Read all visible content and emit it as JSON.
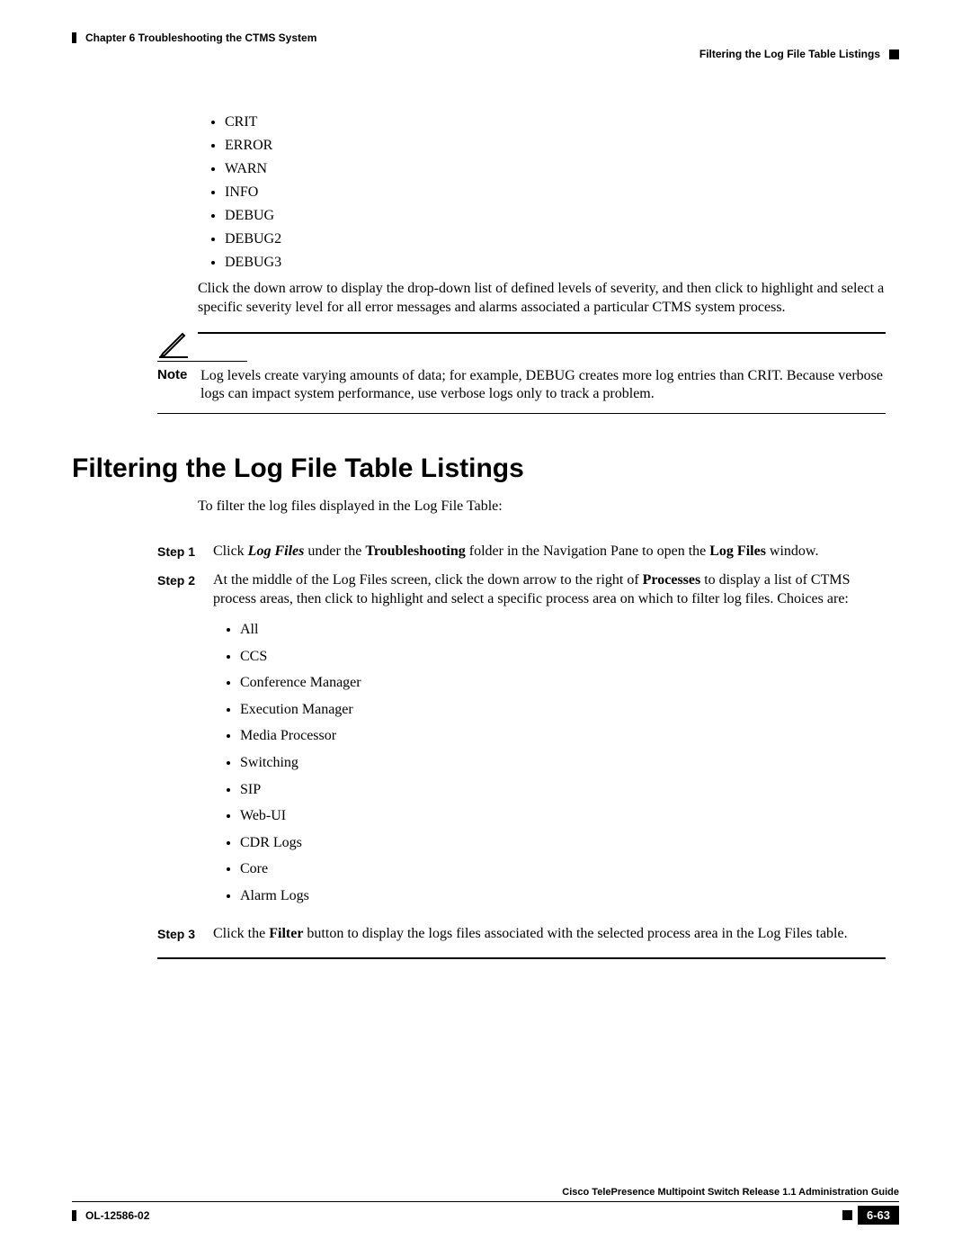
{
  "header": {
    "chapter": "Chapter 6    Troubleshooting the CTMS System",
    "section_ref": "Filtering the Log File Table Listings"
  },
  "severity_levels": [
    "CRIT",
    "ERROR",
    "WARN",
    "INFO",
    "DEBUG",
    "DEBUG2",
    "DEBUG3"
  ],
  "severity_para": "Click the down arrow to display the drop-down list of defined levels of severity, and then click to highlight and select a specific severity level for all error messages and alarms associated a particular CTMS system process.",
  "note": {
    "label": "Note",
    "text": "Log levels create varying amounts of data; for example, DEBUG creates more log entries than CRIT. Because verbose logs can impact system performance, use verbose logs only to track a problem."
  },
  "section_title": "Filtering the Log File Table Listings",
  "intro": "To filter the log files displayed in the Log File Table:",
  "steps": {
    "s1_label": "Step 1",
    "s1_pre": "Click ",
    "s1_logfiles": "Log Files",
    "s1_mid1": " under the ",
    "s1_trouble": "Troubleshooting",
    "s1_mid2": " folder in the Navigation Pane to open the ",
    "s1_logfiles2": "Log Files",
    "s1_end": " window.",
    "s2_label": "Step 2",
    "s2_pre": "At the middle of the Log Files screen, click the down arrow to the right of ",
    "s2_proc": "Processes",
    "s2_end": " to display a list of CTMS process areas, then click to highlight and select a specific process area on which to filter log files. Choices are:",
    "s3_label": "Step 3",
    "s3_pre": "Click the ",
    "s3_filter": "Filter",
    "s3_end": " button to display the logs files associated with the selected process area in the Log Files table."
  },
  "process_choices": [
    "All",
    "CCS",
    "Conference Manager",
    "Execution Manager",
    "Media Processor",
    "Switching",
    "SIP",
    "Web-UI",
    "CDR Logs",
    "Core",
    "Alarm Logs"
  ],
  "footer": {
    "guide": "Cisco TelePresence Multipoint Switch Release 1.1 Administration Guide",
    "ol": "OL-12586-02",
    "page": "6-63"
  }
}
